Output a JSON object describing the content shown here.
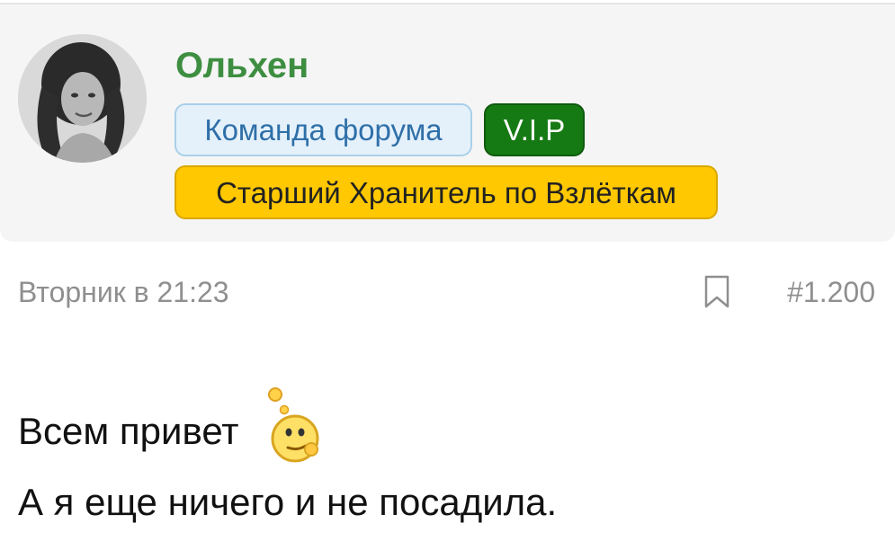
{
  "author": {
    "name": "Ольхен",
    "badges": {
      "team": "Команда форума",
      "vip": "V.I.P",
      "title": "Старший Хранитель по Взлёткам"
    }
  },
  "post": {
    "date": "Вторник в 21:23",
    "number": "#1.200",
    "lines": [
      "Всем привет",
      "А я еще ничего и не посадила."
    ],
    "emoji": "thinking-smiley-icon"
  },
  "colors": {
    "username": "#3e8e41",
    "team_badge_bg": "#e4f1fb",
    "team_badge_text": "#2f6fa8",
    "vip_badge_bg": "#157a13",
    "title_badge_bg": "#ffc800",
    "meta_text": "#8f8f8f"
  }
}
